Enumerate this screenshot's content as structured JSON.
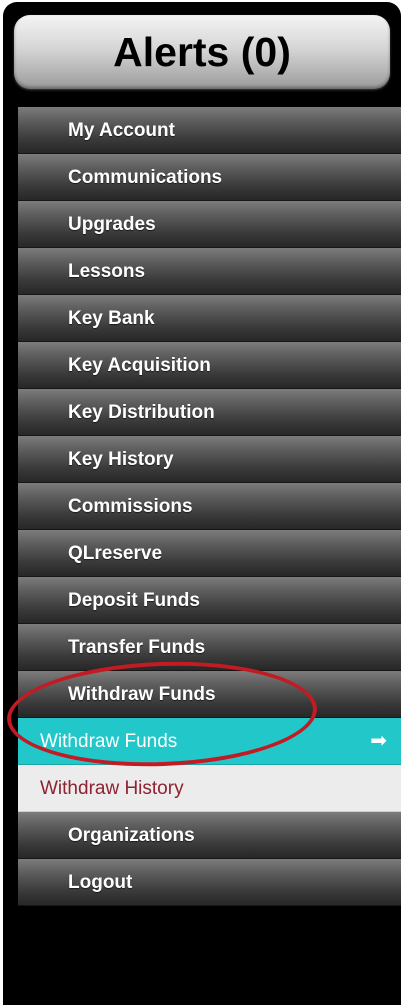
{
  "alerts": {
    "label": "Alerts (0)"
  },
  "menu": {
    "items": [
      {
        "label": "My Account"
      },
      {
        "label": "Communications"
      },
      {
        "label": "Upgrades"
      },
      {
        "label": "Lessons"
      },
      {
        "label": "Key Bank"
      },
      {
        "label": "Key Acquisition"
      },
      {
        "label": "Key Distribution"
      },
      {
        "label": "Key History"
      },
      {
        "label": "Commissions"
      },
      {
        "label": "QLreserve"
      },
      {
        "label": "Deposit Funds"
      },
      {
        "label": "Transfer Funds"
      },
      {
        "label": "Withdraw Funds"
      }
    ],
    "active_item": {
      "label": "Withdraw Funds",
      "icon": "arrow-right-icon"
    },
    "sub_item": {
      "label": "Withdraw History"
    },
    "bottom_items": [
      {
        "label": "Organizations"
      },
      {
        "label": "Logout"
      }
    ]
  },
  "colors": {
    "active_bg": "#21c7c9",
    "sub_text": "#8e2230",
    "annotation": "#c21b24"
  }
}
